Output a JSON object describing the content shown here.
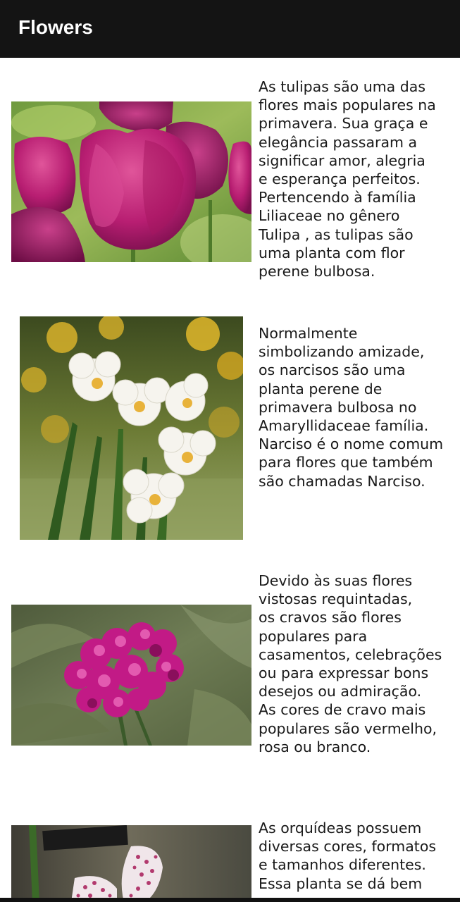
{
  "app_bar": {
    "title": "Flowers"
  },
  "flowers": [
    {
      "image": "tulips-photo",
      "description": "As tulipas são uma das\nflores mais populares na\nprimavera. Sua graça e\nelegância passaram a\nsignificar amor, alegria\ne esperança perfeitos.\nPertencendo à família\nLiliaceae no gênero\nTulipa , as tulipas são\numa planta com flor\nperene bulbosa."
    },
    {
      "image": "daffodils-photo",
      "description": "Normalmente\nsimbolizando amizade,\nos narcisos são uma\nplanta perene de\nprimavera bulbosa no\nAmaryllidaceae família.\nNarciso é o nome comum\npara flores que também\nsão chamadas Narciso."
    },
    {
      "image": "carnations-photo",
      "description": "Devido às suas flores\nvistosas requintadas,\nos cravos são flores\npopulares para\ncasamentos, celebrações\nou para expressar bons\ndesejos ou admiração.\nAs cores de cravo mais\npopulares são vermelho,\nrosa ou branco."
    },
    {
      "image": "orchid-photo",
      "description": "As orquídeas possuem\ndiversas cores, formatos\ne tamanhos diferentes.\nEssa planta se dá bem"
    }
  ]
}
